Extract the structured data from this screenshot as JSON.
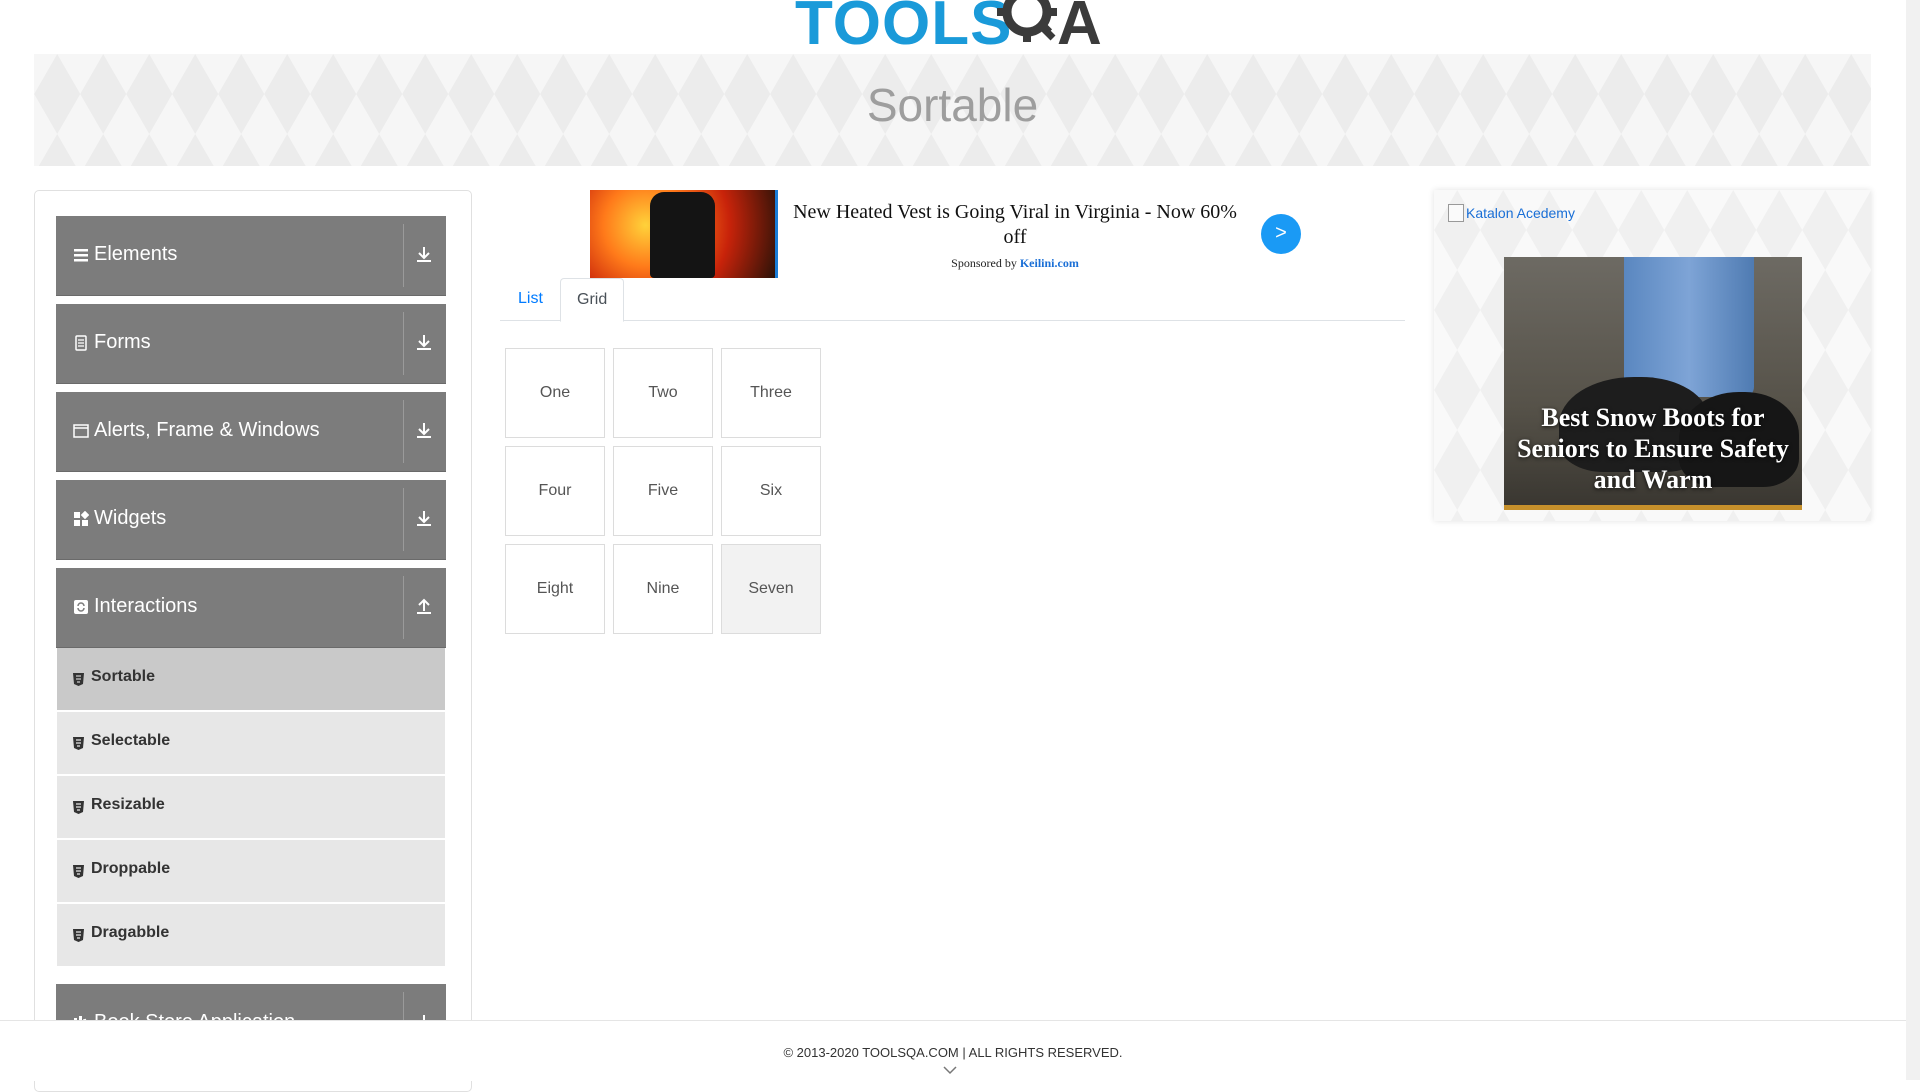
{
  "header": {
    "logo_text": "TOOLS",
    "logo_text_b": "A"
  },
  "page": {
    "title": "Sortable"
  },
  "sidebar": {
    "groups": [
      {
        "label": "Elements",
        "icon": "list-icon",
        "expanded": false
      },
      {
        "label": "Forms",
        "icon": "document-icon",
        "expanded": false
      },
      {
        "label": "Alerts, Frame & Windows",
        "icon": "window-icon",
        "expanded": false
      },
      {
        "label": "Widgets",
        "icon": "widgets-icon",
        "expanded": false
      },
      {
        "label": "Interactions",
        "icon": "refresh-icon",
        "expanded": true
      },
      {
        "label": "Book Store Application",
        "icon": "books-icon",
        "expanded": false
      }
    ],
    "interaction_items": [
      {
        "label": "Sortable",
        "active": true
      },
      {
        "label": "Selectable",
        "active": false
      },
      {
        "label": "Resizable",
        "active": false
      },
      {
        "label": "Droppable",
        "active": false
      },
      {
        "label": "Dragabble",
        "active": false
      }
    ]
  },
  "ad_top": {
    "headline": "New Heated Vest is Going Viral in Virginia - Now 60% off",
    "sponsored_prefix": "Sponsored by",
    "sponsor": "Keilini.com",
    "arrow": ">"
  },
  "tabs": [
    {
      "label": "List",
      "active": false
    },
    {
      "label": "Grid",
      "active": true
    }
  ],
  "grid_items": [
    "One",
    "Two",
    "Three",
    "Four",
    "Five",
    "Six",
    "Eight",
    "Nine",
    "Seven"
  ],
  "side_ad": {
    "alt_link": "Katalon Acedemy",
    "caption": "Best Snow Boots for Seniors to Ensure Safety and Warm"
  },
  "footer": {
    "copyright": "© 2013-2020 TOOLSQA.COM | ALL RIGHTS RESERVED."
  },
  "colors": {
    "accent": "#007bff",
    "sidebar_group": "#7c7c7c",
    "logo_blue": "#1a9ad9"
  }
}
